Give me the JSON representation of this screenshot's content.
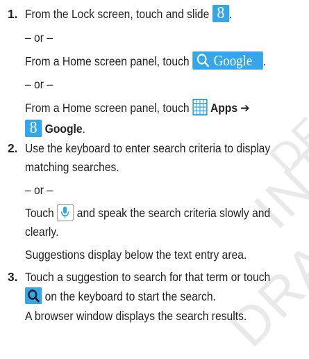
{
  "steps": [
    {
      "number": "1.",
      "line1": {
        "before": "From the Lock screen, touch and slide",
        "after": "."
      },
      "or1": "– or –",
      "line2": {
        "before": "From a Home screen panel, touch",
        "after": "."
      },
      "or2": "– or –",
      "line3": {
        "before": "From a Home screen panel, touch",
        "apps": "Apps ➔"
      },
      "line4": {
        "google": "Google",
        "after": "."
      }
    },
    {
      "number": "2.",
      "line1": "Use the keyboard to enter search criteria to display",
      "line2": "matching searches.",
      "or": "– or –",
      "line3": {
        "before": "Touch",
        "after": "and speak the search criteria slowly and"
      },
      "line4": "clearly.",
      "line5": "Suggestions display below the text entry area."
    },
    {
      "number": "3.",
      "line1": "Touch a suggestion to search for that term or touch",
      "line2": "on the keyboard to start the search.",
      "line3": "A browser window displays the search results."
    }
  ],
  "icons": {
    "google_app_glyph": "8",
    "google_search_bar_text": "Google",
    "accent_color": "#35a6e6"
  },
  "watermark": [
    "DRAFT",
    "INTERNAL",
    "DF"
  ]
}
